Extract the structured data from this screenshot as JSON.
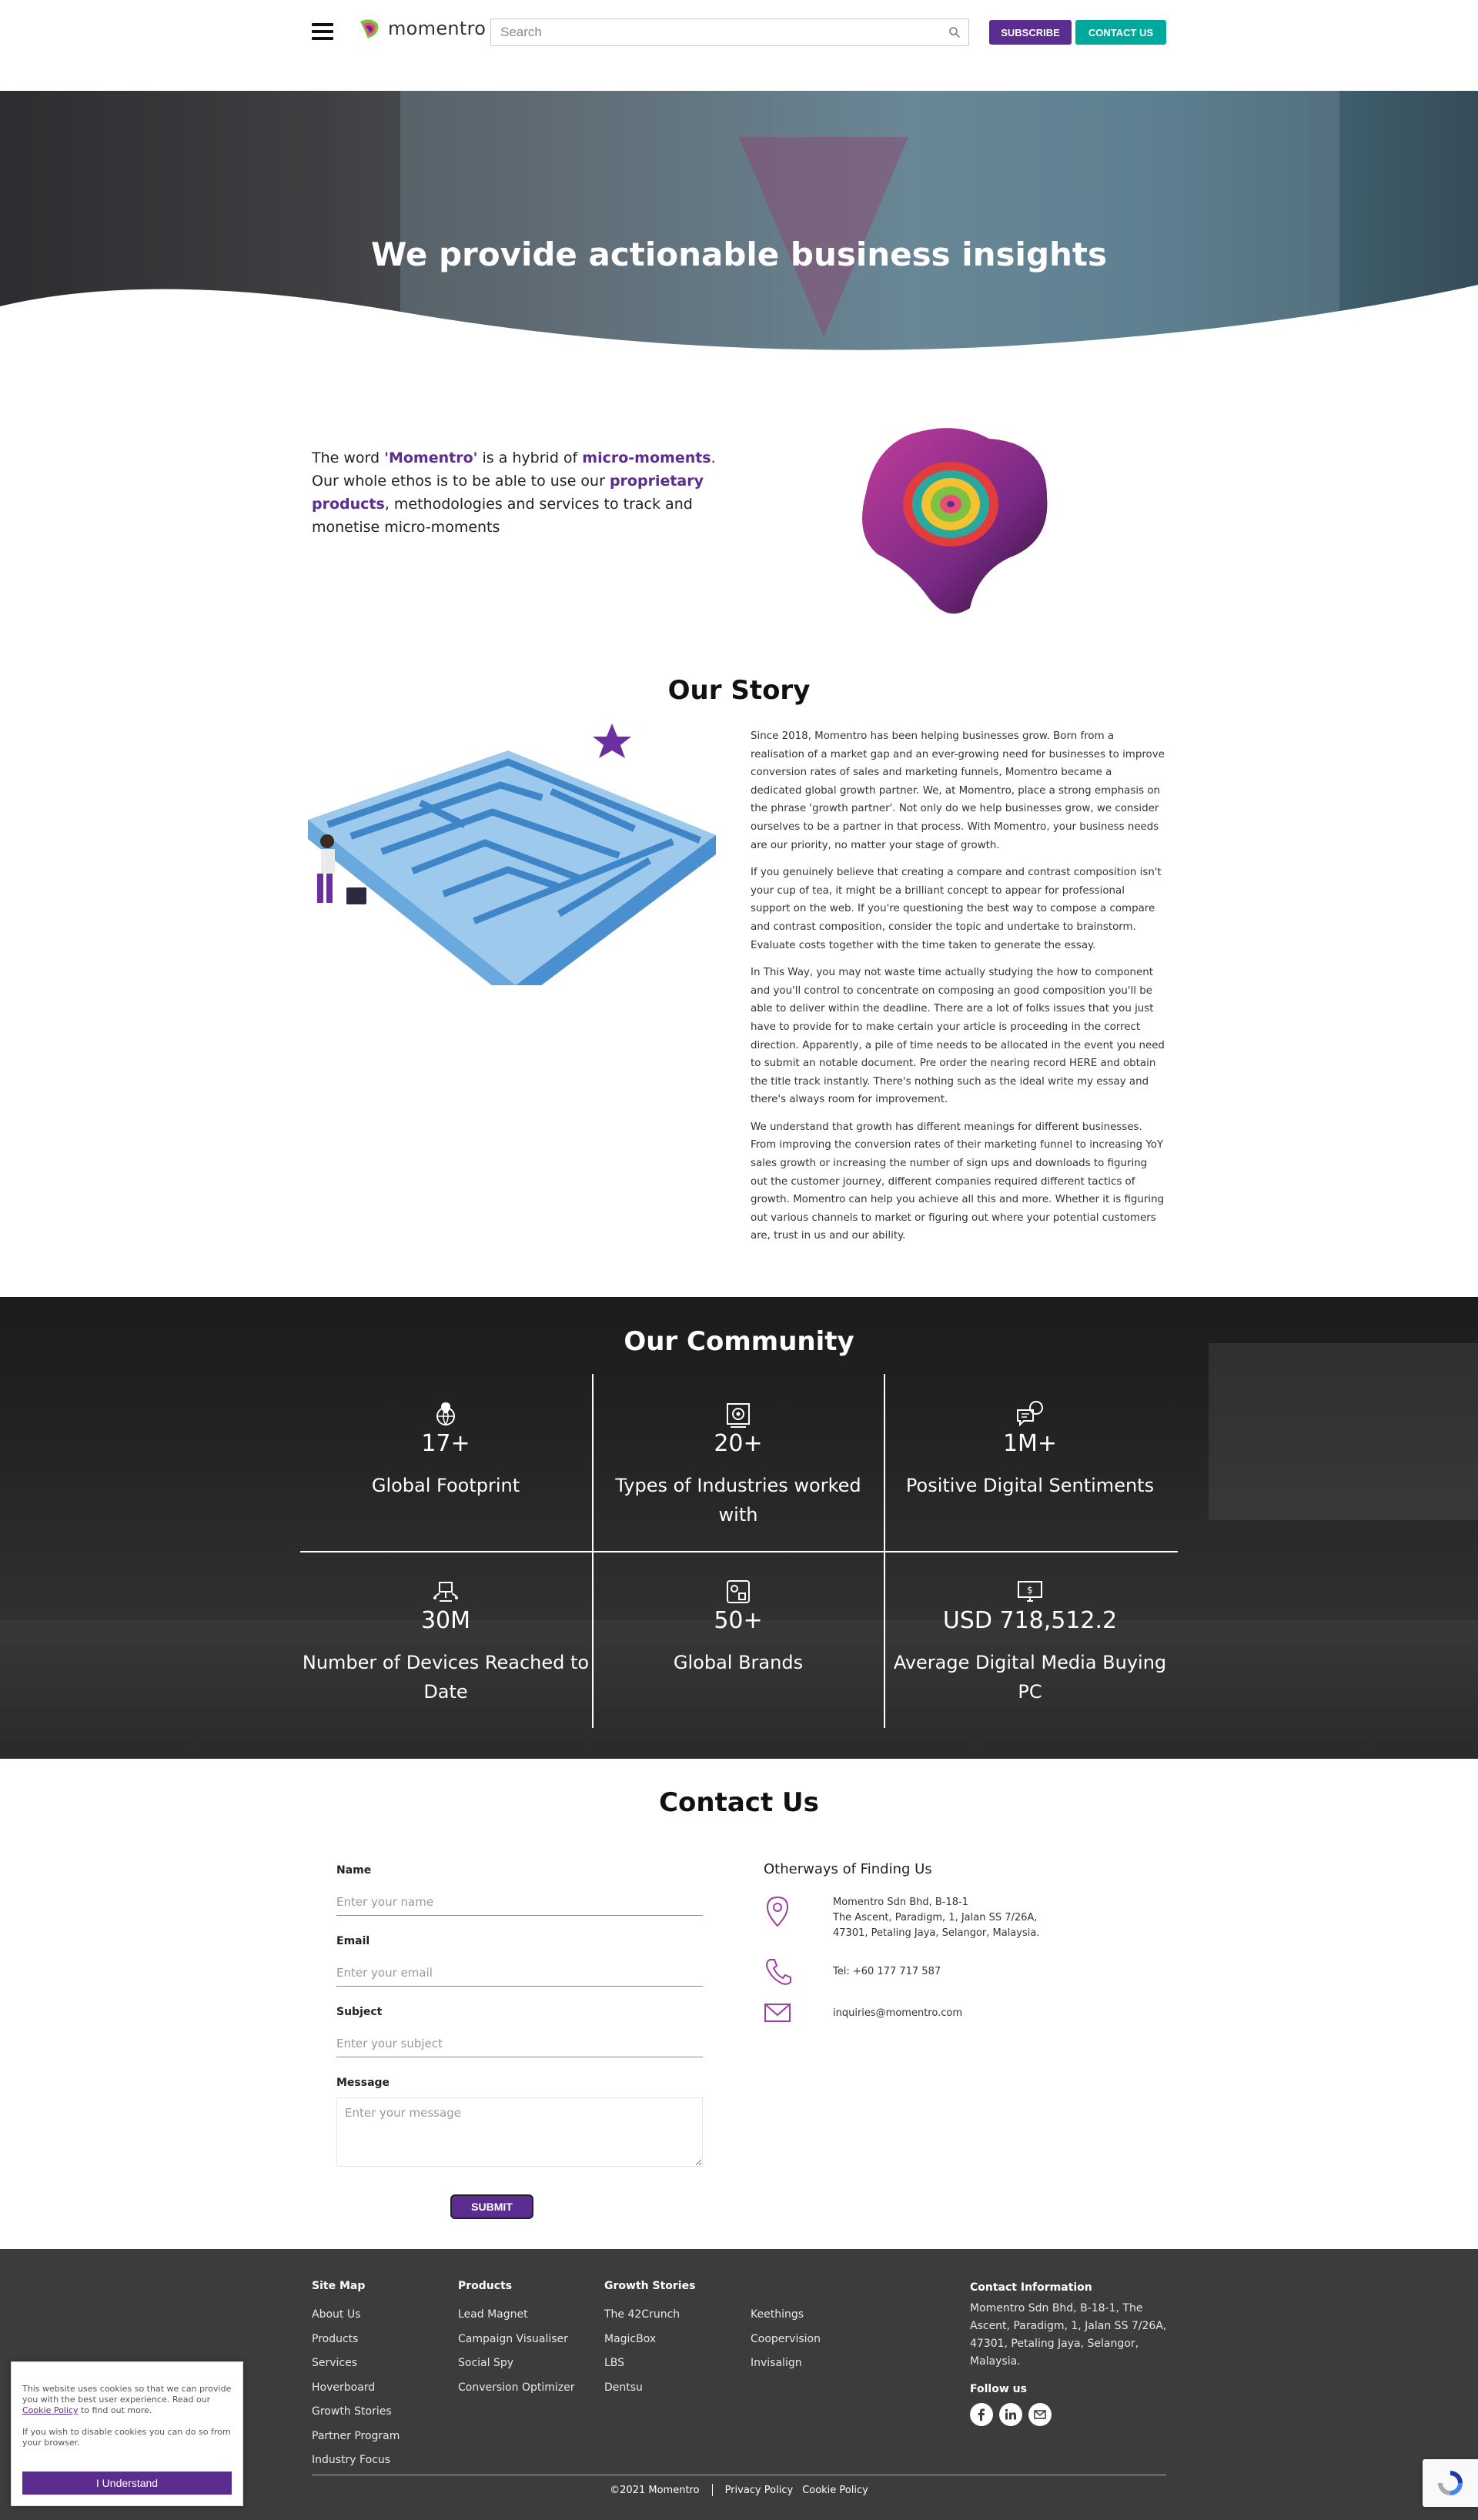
{
  "header": {
    "logo_text": "momentro",
    "search_placeholder": "Search",
    "subscribe_label": "SUBSCRIBE",
    "contact_label": "CONTACT US"
  },
  "hero": {
    "title": "We provide actionable business insights"
  },
  "intro": {
    "part1": "The word ",
    "hl1": "'Momentro'",
    "part2": " is a hybrid of ",
    "hl2": "micro-moments",
    "part3": ". Our whole ethos is to be able to use our ",
    "hl3": "proprietary products",
    "part4": ", methodologies and services to track and monetise micro-moments"
  },
  "story": {
    "title": "Our Story",
    "paragraphs": [
      "Since 2018, Momentro has been helping businesses grow. Born from a realisation of a market gap and an ever-growing need for businesses to improve conversion rates of sales and marketing funnels, Momentro became a dedicated global growth partner. We, at Momentro, place a strong emphasis on the phrase 'growth partner'. Not only do we help businesses grow, we consider ourselves to be a partner in that process. With Momentro, your business needs are our priority, no matter your stage of growth.",
      "If you genuinely believe that creating a compare and contrast composition isn't your cup of tea, it might be a brilliant concept to appear for professional support on the web. If you're questioning the best way to compose a compare and contrast composition, consider the topic and undertake to brainstorm. Evaluate costs together with the time taken to generate the essay.",
      "In This Way, you may not waste time actually studying the how to component and you'll control to concentrate on composing an good composition you'll be able to deliver within the deadline. There are a lot of folks issues that you just have to provide for to make certain your article is proceeding in the correct direction. Apparently, a pile of time needs to be allocated in the event you need to submit an notable document. Pre order the nearing record HERE and obtain the title track instantly. There's nothing such as the ideal write my essay and there's always room for improvement.",
      "We understand that growth has different meanings for different businesses. From improving the conversion rates of their marketing funnel to increasing YoY sales growth or increasing the number of sign ups and downloads to figuring out the customer journey, different companies required different tactics of growth. Momentro can help you achieve all this and more. Whether it is figuring out various channels to market or figuring out where your potential customers are, trust in us and our ability."
    ]
  },
  "community": {
    "title": "Our Community",
    "stats": [
      {
        "icon": "globe-pin-icon",
        "value": "17+",
        "label": "Global Footprint"
      },
      {
        "icon": "industry-gear-icon",
        "value": "20+",
        "label": "Types of Industries worked with"
      },
      {
        "icon": "chat-bubbles-icon",
        "value": "1M+",
        "label": "Positive Digital Sentiments"
      },
      {
        "icon": "devices-icon",
        "value": "30M",
        "label": "Number of Devices Reached to Date"
      },
      {
        "icon": "brands-icon",
        "value": "50+",
        "label": "Global Brands"
      },
      {
        "icon": "money-monitor-icon",
        "value": "USD 718,512.2",
        "label": "Average Digital Media Buying PC"
      }
    ]
  },
  "contact": {
    "title": "Contact Us",
    "fields": {
      "name_label": "Name",
      "name_placeholder": "Enter your name",
      "email_label": "Email",
      "email_placeholder": "Enter your email",
      "subject_label": "Subject",
      "subject_placeholder": "Enter your subject",
      "message_label": "Message",
      "message_placeholder": "Enter your message"
    },
    "submit_label": "SUBMIT",
    "other_title": "Otherways of Finding Us",
    "address_lines": [
      "Momentro Sdn Bhd, B-18-1",
      "The Ascent, Paradigm, 1, Jalan SS 7/26A,",
      "47301, Petaling Jaya, Selangor, Malaysia."
    ],
    "phone": "Tel: +60 177 717 587",
    "email": "inquiries@momentro.com",
    "accent_color": "#9b3fa6"
  },
  "footer": {
    "sitemap_title": "Site Map",
    "sitemap": [
      "About Us",
      "Products",
      "Services",
      "Hoverboard",
      "Growth Stories",
      "Partner Program",
      "Industry Focus"
    ],
    "products_title": "Products",
    "products": [
      "Lead Magnet",
      "Campaign Visualiser",
      "Social Spy",
      "Conversion Optimizer"
    ],
    "growth_title": "Growth Stories",
    "growth": [
      "The 42Crunch",
      "MagicBox",
      "LBS",
      "Dentsu"
    ],
    "growth2": [
      "Keethings",
      "Coopervision",
      "Invisalign"
    ],
    "info_title": "Contact Information",
    "info_text": "Momentro Sdn Bhd, B-18-1, The Ascent, Paradigm, 1, Jalan SS 7/26A, 47301, Petaling Jaya, Selangor, Malaysia.",
    "follow_title": "Follow us",
    "copyright": "©2021 Momentro",
    "privacy": "Privacy Policy",
    "cookie_policy": "Cookie Policy"
  },
  "cookie": {
    "text1_a": "This website uses cookies so that we can provide you with the best user experience. Read our ",
    "text1_link": "Cookie Policy",
    "text1_b": " to find out more.",
    "text2": "If you wish to disable cookies you can do so from your browser.",
    "button": "I Understand"
  },
  "colors": {
    "brand_purple": "#5c2d91",
    "brand_teal": "#00a99d",
    "footer_bg": "#3c3c3c"
  }
}
